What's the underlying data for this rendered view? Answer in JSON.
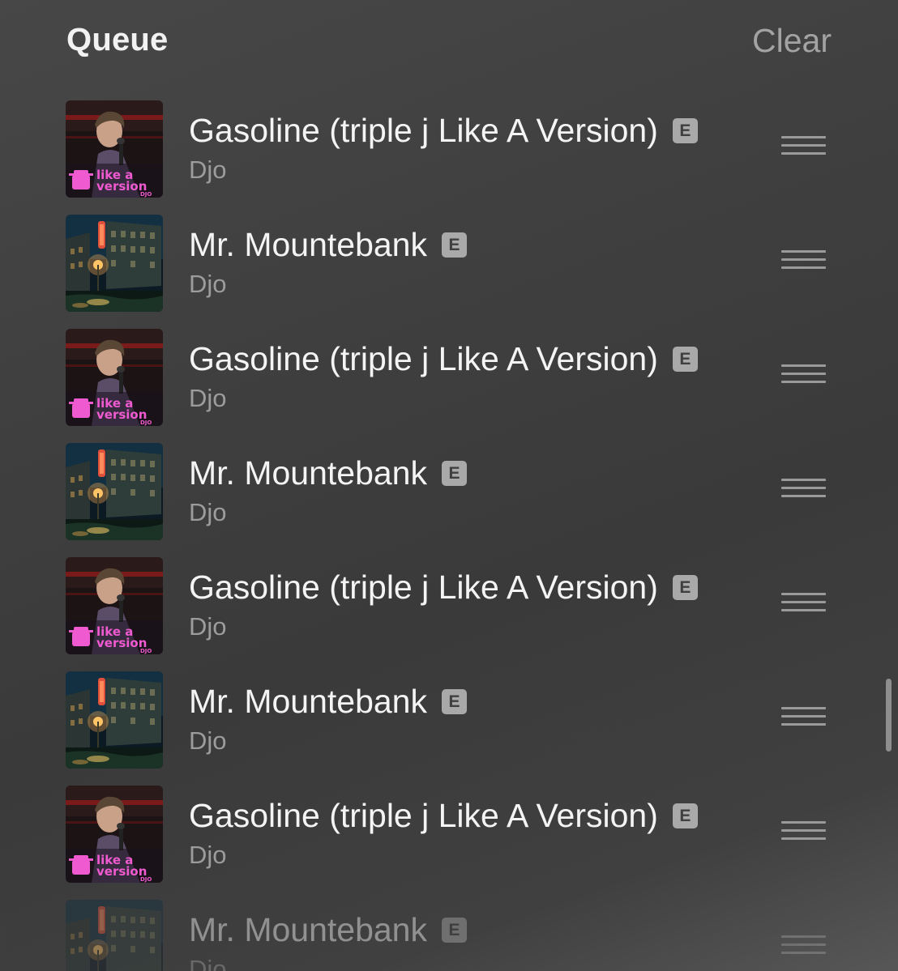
{
  "header": {
    "title": "Queue",
    "clear_label": "Clear"
  },
  "queue": [
    {
      "title": "Gasoline (triple j Like A Version)",
      "artist": "Djo",
      "explicit": "E",
      "artwork": "like-a-version-cover",
      "art_text_1": "like a",
      "art_text_2": "version",
      "art_text_3": "DJO"
    },
    {
      "title": "Mr. Mountebank",
      "artist": "Djo",
      "explicit": "E",
      "artwork": "night-city-street-cover"
    },
    {
      "title": "Gasoline (triple j Like A Version)",
      "artist": "Djo",
      "explicit": "E",
      "artwork": "like-a-version-cover",
      "art_text_1": "like a",
      "art_text_2": "version",
      "art_text_3": "DJO"
    },
    {
      "title": "Mr. Mountebank",
      "artist": "Djo",
      "explicit": "E",
      "artwork": "night-city-street-cover"
    },
    {
      "title": "Gasoline (triple j Like A Version)",
      "artist": "Djo",
      "explicit": "E",
      "artwork": "like-a-version-cover",
      "art_text_1": "like a",
      "art_text_2": "version",
      "art_text_3": "DJO"
    },
    {
      "title": "Mr. Mountebank",
      "artist": "Djo",
      "explicit": "E",
      "artwork": "night-city-street-cover"
    },
    {
      "title": "Gasoline (triple j Like A Version)",
      "artist": "Djo",
      "explicit": "E",
      "artwork": "like-a-version-cover",
      "art_text_1": "like a",
      "art_text_2": "version",
      "art_text_3": "DJO"
    },
    {
      "title": "Mr. Mountebank",
      "artist": "Djo",
      "explicit": "E",
      "artwork": "night-city-street-cover"
    }
  ],
  "icons": {
    "drag_handle": "drag-handle-icon",
    "explicit": "explicit-badge"
  },
  "colors": {
    "background": "#3f3f3f",
    "title_text": "#f4f4f4",
    "secondary_text": "#9c9c9c",
    "clear_text": "#a3a3a3",
    "art_pink": "#f05ad0"
  }
}
